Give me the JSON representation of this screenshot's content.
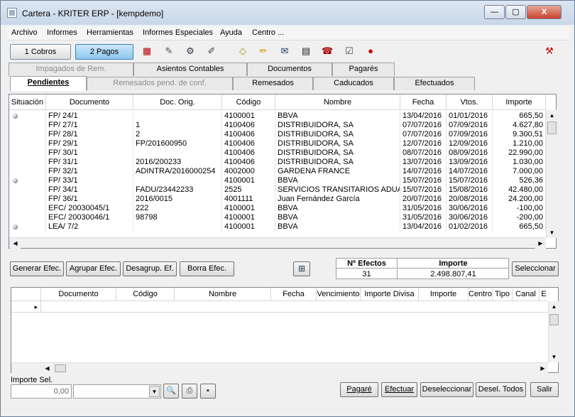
{
  "window": {
    "title": "Cartera - KRITER ERP - [kempdemo]",
    "min": "—",
    "max": "▢",
    "close": "X"
  },
  "menu": [
    "Archivo",
    "Informes",
    "Herramientas",
    "Informes Especiales",
    "Ayuda",
    "Centro ..."
  ],
  "toolbar": {
    "cobros": "1 Cobros",
    "pagos": "2 Pagos"
  },
  "tabs_row1": [
    "Impagados de Rem.",
    "Asientos Contables",
    "Documentos",
    "Pagarés"
  ],
  "tabs_row2": [
    "Pendientes",
    "Remesados pend. de conf.",
    "Remesados",
    "Caducados",
    "Efectuados"
  ],
  "grid1": {
    "headers": [
      "Situación",
      "Documento",
      "Doc. Orig.",
      "Código",
      "Nombre",
      "Fecha",
      "Vtos.",
      "Importe"
    ],
    "rows": [
      {
        "dot": true,
        "doc": "FP/ 24/1",
        "orig": "",
        "cod": "4100001",
        "nombre": "BBVA",
        "fecha": "13/04/2016",
        "vto": "01/01/2016",
        "imp": "665,50"
      },
      {
        "dot": false,
        "doc": "FP/ 27/1",
        "orig": "1",
        "cod": "4100406",
        "nombre": "DISTRIBUIDORA, SA",
        "fecha": "07/07/2016",
        "vto": "07/09/2016",
        "imp": "4.627,80"
      },
      {
        "dot": false,
        "doc": "FP/ 28/1",
        "orig": "2",
        "cod": "4100406",
        "nombre": "DISTRIBUIDORA, SA",
        "fecha": "07/07/2016",
        "vto": "07/09/2016",
        "imp": "9.300,51"
      },
      {
        "dot": false,
        "doc": "FP/ 29/1",
        "orig": "FP/201600950",
        "cod": "4100406",
        "nombre": "DISTRIBUIDORA, SA",
        "fecha": "12/07/2016",
        "vto": "12/09/2016",
        "imp": "1.210,00"
      },
      {
        "dot": false,
        "doc": "FP/ 30/1",
        "orig": "",
        "cod": "4100406",
        "nombre": "DISTRIBUIDORA, SA",
        "fecha": "08/07/2016",
        "vto": "08/09/2016",
        "imp": "22.990,00"
      },
      {
        "dot": false,
        "doc": "FP/ 31/1",
        "orig": "2016/200233",
        "cod": "4100406",
        "nombre": "DISTRIBUIDORA, SA",
        "fecha": "13/07/2016",
        "vto": "13/09/2016",
        "imp": "1.030,00"
      },
      {
        "dot": false,
        "doc": "FP/ 32/1",
        "orig": "ADINTRA/2016000254",
        "cod": "4002000",
        "nombre": "GARDENA FRANCE",
        "fecha": "14/07/2016",
        "vto": "14/07/2016",
        "imp": "7.000,00"
      },
      {
        "dot": true,
        "doc": "FP/ 33/1",
        "orig": "",
        "cod": "4100001",
        "nombre": "BBVA",
        "fecha": "15/07/2016",
        "vto": "15/07/2016",
        "imp": "526,36"
      },
      {
        "dot": false,
        "doc": "FP/ 34/1",
        "orig": "FADU/23442233",
        "cod": "2525",
        "nombre": "SERVICIOS TRANSITARIOS ADUA",
        "fecha": "15/07/2016",
        "vto": "15/08/2016",
        "imp": "42.480,00"
      },
      {
        "dot": false,
        "doc": "FP/ 36/1",
        "orig": "2016/0015",
        "cod": "4001111",
        "nombre": "Juan Fernández García",
        "fecha": "20/07/2016",
        "vto": "20/08/2016",
        "imp": "24.200,00"
      },
      {
        "dot": false,
        "doc": "EFC/ 20030045/1",
        "orig": "222",
        "cod": "4100001",
        "nombre": "BBVA",
        "fecha": "31/05/2016",
        "vto": "30/06/2016",
        "imp": "-100,00"
      },
      {
        "dot": false,
        "doc": "EFC/ 20030046/1",
        "orig": "98798",
        "cod": "4100001",
        "nombre": "BBVA",
        "fecha": "31/05/2016",
        "vto": "30/06/2016",
        "imp": "-200,00"
      },
      {
        "dot": true,
        "doc": "LEA/ 7/2",
        "orig": "",
        "cod": "4100001",
        "nombre": "BBVA",
        "fecha": "13/04/2016",
        "vto": "01/02/2016",
        "imp": "665,50"
      }
    ]
  },
  "actions": {
    "generar": "Generar Efec.",
    "agrupar": "Agrupar Efec.",
    "desagrup": "Desagrup. Ef.",
    "borra": "Borra Efec.",
    "seleccionar": "Seleccionar"
  },
  "summary": {
    "efectos_label": "Nº Efectos",
    "importe_label": "Importe",
    "efectos": "31",
    "importe": "2.498.807,41"
  },
  "grid2": {
    "headers": [
      "Documento",
      "Código",
      "Nombre",
      "Fecha",
      "Vencimiento",
      "Importe Divisa",
      "Importe",
      "Centro",
      "Tipo",
      "Canal",
      "E"
    ]
  },
  "footer": {
    "importe_sel_label": "Importe Sel.",
    "importe_sel": "0,00",
    "pagare": "Pagaré",
    "efectuar": "Efectuar",
    "deseleccionar": "Deseleccionar",
    "desel_todos": "Desel. Todos",
    "salir": "Salir"
  }
}
